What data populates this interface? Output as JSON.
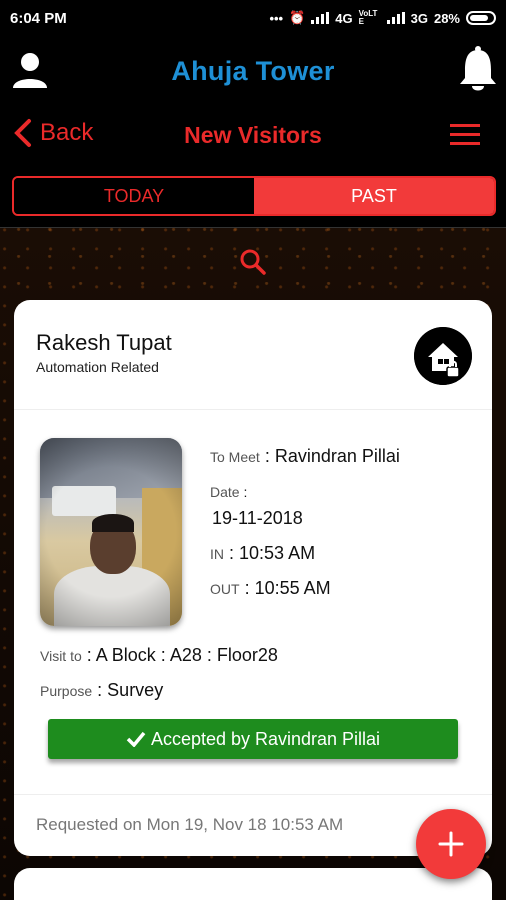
{
  "status_bar": {
    "time": "6:04 PM",
    "indicators": "4G",
    "volte": "VoLTE",
    "net": "3G",
    "battery": "28%"
  },
  "header": {
    "title": "Ahuja Tower",
    "icons": [
      "user-icon",
      "bell-icon"
    ]
  },
  "nav": {
    "back_label": "Back",
    "title": "New Visitors",
    "icons": [
      "chevron-left-icon",
      "menu-icon"
    ]
  },
  "tabs": [
    {
      "label": "TODAY",
      "active": false
    },
    {
      "label": "PAST",
      "active": true
    }
  ],
  "colors": {
    "accent": "#f23a3a",
    "title_blue": "#1e90d6",
    "accepted_green": "#1e8c1e"
  },
  "visitor_card": {
    "name": "Rakesh Tupat",
    "category": "Automation Related",
    "to_meet_label": "To Meet",
    "to_meet_value": "Ravindran Pillai",
    "date_label": "Date",
    "date_value": "19-11-2018",
    "in_label": "IN",
    "in_value": "10:53 AM",
    "out_label": "OUT",
    "out_value": "10:55 AM",
    "visit_to_label": "Visit to",
    "visit_to_value": "A Block : A28 : Floor28",
    "purpose_label": "Purpose",
    "purpose_value": "Survey",
    "status_text": "Accepted by Ravindran Pillai",
    "requested_text": "Requested on Mon 19, Nov 18 10:53 AM"
  },
  "fab": {
    "icon": "plus-icon"
  }
}
